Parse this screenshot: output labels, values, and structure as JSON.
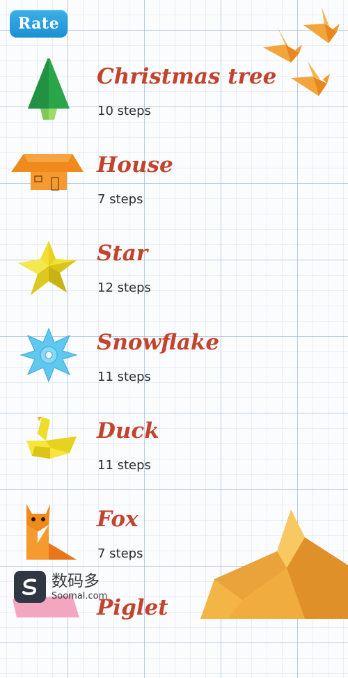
{
  "header": {
    "rate_label": "Rate"
  },
  "items": [
    {
      "title": "Christmas tree",
      "steps": "10 steps",
      "icon": "christmas-tree"
    },
    {
      "title": "House",
      "steps": "7 steps",
      "icon": "house"
    },
    {
      "title": "Star",
      "steps": "12 steps",
      "icon": "star"
    },
    {
      "title": "Snowflake",
      "steps": "11 steps",
      "icon": "snowflake"
    },
    {
      "title": "Duck",
      "steps": "11 steps",
      "icon": "duck"
    },
    {
      "title": "Fox",
      "steps": "7 steps",
      "icon": "fox"
    },
    {
      "title": "Piglet",
      "steps": "",
      "icon": "piglet"
    }
  ],
  "watermark": {
    "chinese": "数码多",
    "domain": "Soomal.com"
  },
  "colors": {
    "title": "#c2442d",
    "rate_button": "#1c8fd3",
    "grid": "#96afdc",
    "paper": "#fbfcfe"
  }
}
